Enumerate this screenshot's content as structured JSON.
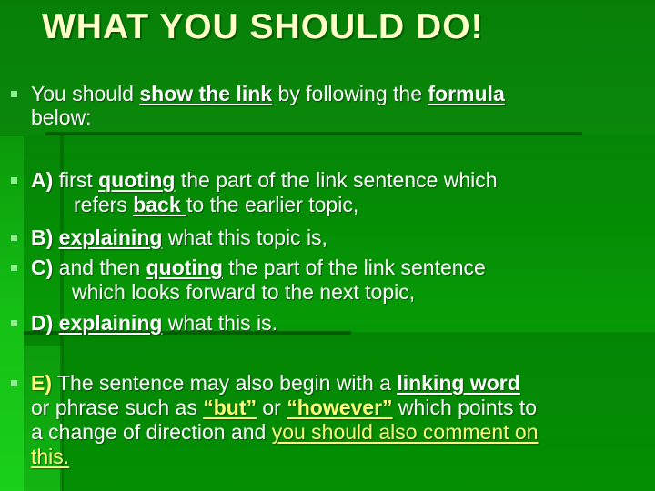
{
  "slide": {
    "title": "WHAT YOU SHOULD DO!",
    "colors": {
      "background": "#048a04",
      "title": "#ffffc8",
      "body_text": "#ffffff",
      "highlight_text": "#ffff7a",
      "bullet": "#8cf08c"
    },
    "bullet_icon": "square-bullet",
    "intro": {
      "line1_pre": "You should ",
      "line1_bold": "show the link",
      "line1_mid": " by following the ",
      "line1_bold2": "formula",
      "line2": "below:"
    },
    "steps": [
      {
        "label": "A)",
        "line1_pre": " first ",
        "line1_bold": "quoting",
        "line1_post": " the part of the link sentence which",
        "line2_pre": "refers ",
        "line2_bold": "back ",
        "line2_post": "to the earlier topic,"
      },
      {
        "label": "B)",
        "line1_bold": "explaining",
        "line1_post": " what this topic is,"
      },
      {
        "label": "C)",
        "line1_pre": " and then ",
        "line1_bold": "quoting",
        "line1_post": " the part of the link sentence",
        "line2": "which looks forward to the next topic,"
      },
      {
        "label": "D)",
        "line1_bold": "explaining",
        "line1_post": " what this is."
      }
    ],
    "note": {
      "label": "E)",
      "line1_pre": " The sentence may also begin with a ",
      "line1_bold": "linking word",
      "line2_pre": "or phrase such as ",
      "line2_q1": "“but”",
      "line2_mid": " or ",
      "line2_q2": "“however”",
      "line2_post": " which points to",
      "line3_pre": "a change of direction and ",
      "line3_highlight": "you should also comment on",
      "line4_highlight": "this."
    }
  }
}
